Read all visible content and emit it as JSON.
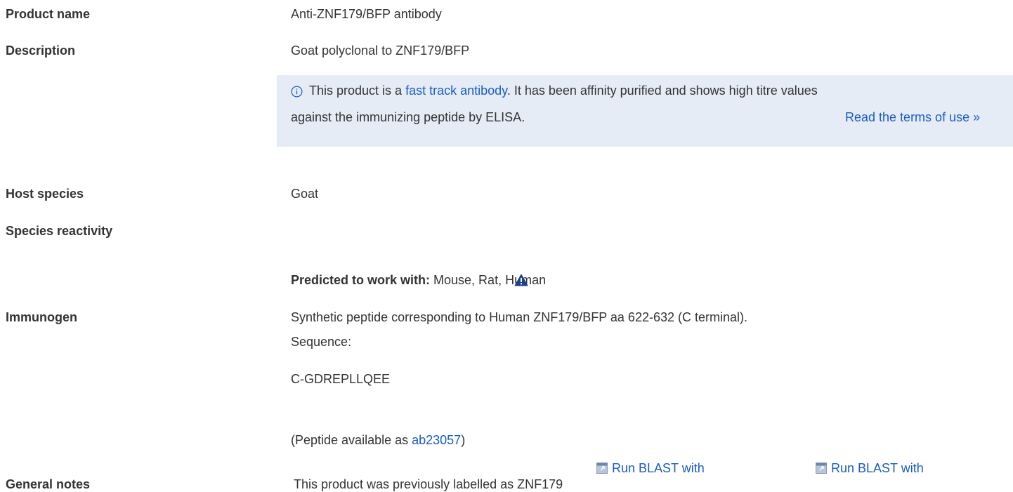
{
  "rows": {
    "product_name": {
      "label": "Product name",
      "value": "Anti-ZNF179/BFP antibody"
    },
    "description": {
      "label": "Description",
      "value": "Goat polyclonal to ZNF179/BFP"
    },
    "host_species": {
      "label": "Host species",
      "value": "Goat"
    },
    "species_reactivity": {
      "label": "Species reactivity",
      "predicted_label": "Predicted to work with:",
      "predicted_value": " Mouse, Rat, Human",
      "warning_icon": "warning-triangle-icon"
    },
    "immunogen": {
      "label": "Immunogen",
      "line1": "Synthetic peptide corresponding to Human ZNF179/BFP aa 622-632 (C terminal).",
      "line2": "Sequence:",
      "sequence": "C-GDREPLLQEE",
      "peptide_prefix": "(Peptide available as ",
      "peptide_link": "ab23057",
      "peptide_suffix": ")",
      "blast_link_1": "Run BLAST with",
      "blast_link_2": "Run BLAST with",
      "blast_icon": "external-window-icon"
    },
    "general_notes": {
      "label": "General notes",
      "value": "This product was previously labelled as ZNF179"
    }
  },
  "notice": {
    "icon": "info-icon",
    "text_prefix": "This product is a ",
    "link": "fast track antibody",
    "text_suffix": ". It has been affinity purified and shows high titre values",
    "line2": "against the immunizing peptide by ELISA.",
    "terms_link": "Read the terms of use »"
  },
  "colors": {
    "link": "#1a5cc4",
    "notice_bg": "#e6ecf6",
    "text": "#333333",
    "warning": "#1f3f8a"
  }
}
